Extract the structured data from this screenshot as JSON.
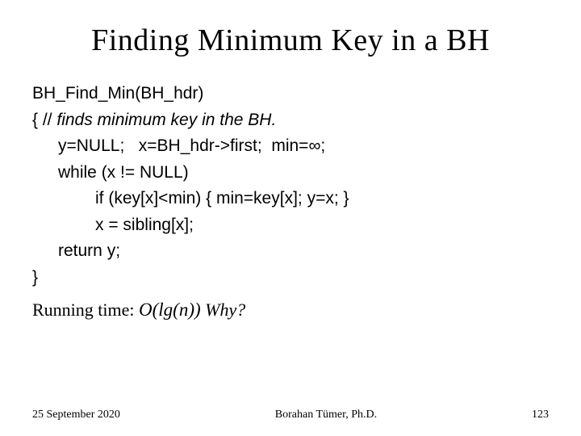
{
  "title": "Finding Minimum Key in a BH",
  "code": {
    "l1": "BH_Find_Min(BH_hdr)",
    "l2a": "{ // ",
    "l2b": "finds minimum key in the BH.",
    "l3": "y=NULL;   x=BH_hdr->first;  min=∞;",
    "l4": "while (x != NULL)",
    "l5": "if (key[x]<min) { min=key[x]; y=x; }",
    "l6": "x = sibling[x];",
    "l7": "return y;",
    "l8": "}"
  },
  "running": {
    "prefix": "Running time: ",
    "complexity": "O(lg(n))",
    "suffix": " Why?"
  },
  "footer": {
    "date": "25 September 2020",
    "author": "Borahan Tümer, Ph.D.",
    "page": "123"
  }
}
